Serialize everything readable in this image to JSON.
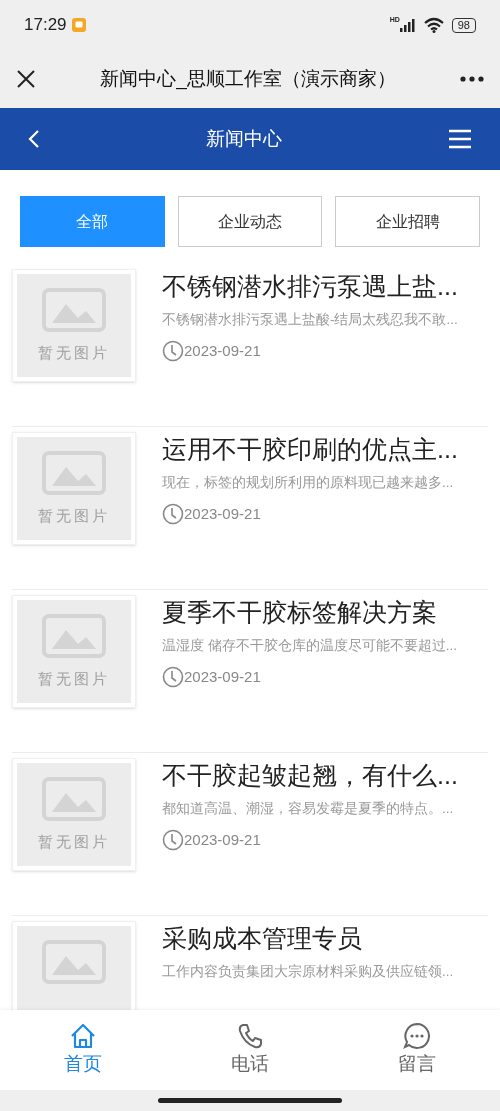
{
  "status_bar": {
    "time": "17:29",
    "network": "HD",
    "battery": "98"
  },
  "title_bar": {
    "title": "新闻中心_思顺工作室（演示商家）"
  },
  "header": {
    "title": "新闻中心"
  },
  "tabs": [
    {
      "label": "全部",
      "selected": true
    },
    {
      "label": "企业动态",
      "selected": false
    },
    {
      "label": "企业招聘",
      "selected": false
    }
  ],
  "articles": [
    {
      "title": "不锈钢潜水排污泵遇上盐...",
      "summary": "不锈钢潜水排污泵遇上盐酸-结局太残忍我不敢...",
      "date": "2023-09-21",
      "placeholder_text": "暂无图片"
    },
    {
      "title": "运用不干胶印刷的优点主...",
      "summary": "现在，标签的规划所利用的原料现已越来越多...",
      "date": "2023-09-21",
      "placeholder_text": "暂无图片"
    },
    {
      "title": "夏季不干胶标签解决方案",
      "summary": "温湿度 储存不干胶仓库的温度尽可能不要超过...",
      "date": "2023-09-21",
      "placeholder_text": "暂无图片"
    },
    {
      "title": "不干胶起皱起翘，有什么...",
      "summary": "都知道高温、潮湿，容易发霉是夏季的特点。...",
      "date": "2023-09-21",
      "placeholder_text": "暂无图片"
    },
    {
      "title": "采购成本管理专员",
      "summary": "工作内容负责集团大宗原材料采购及供应链领..."
    }
  ],
  "bottom_nav": [
    {
      "label": "首页",
      "kind": "home",
      "selected": true
    },
    {
      "label": "电话",
      "kind": "phone",
      "selected": false
    },
    {
      "label": "留言",
      "kind": "message",
      "selected": false
    }
  ]
}
